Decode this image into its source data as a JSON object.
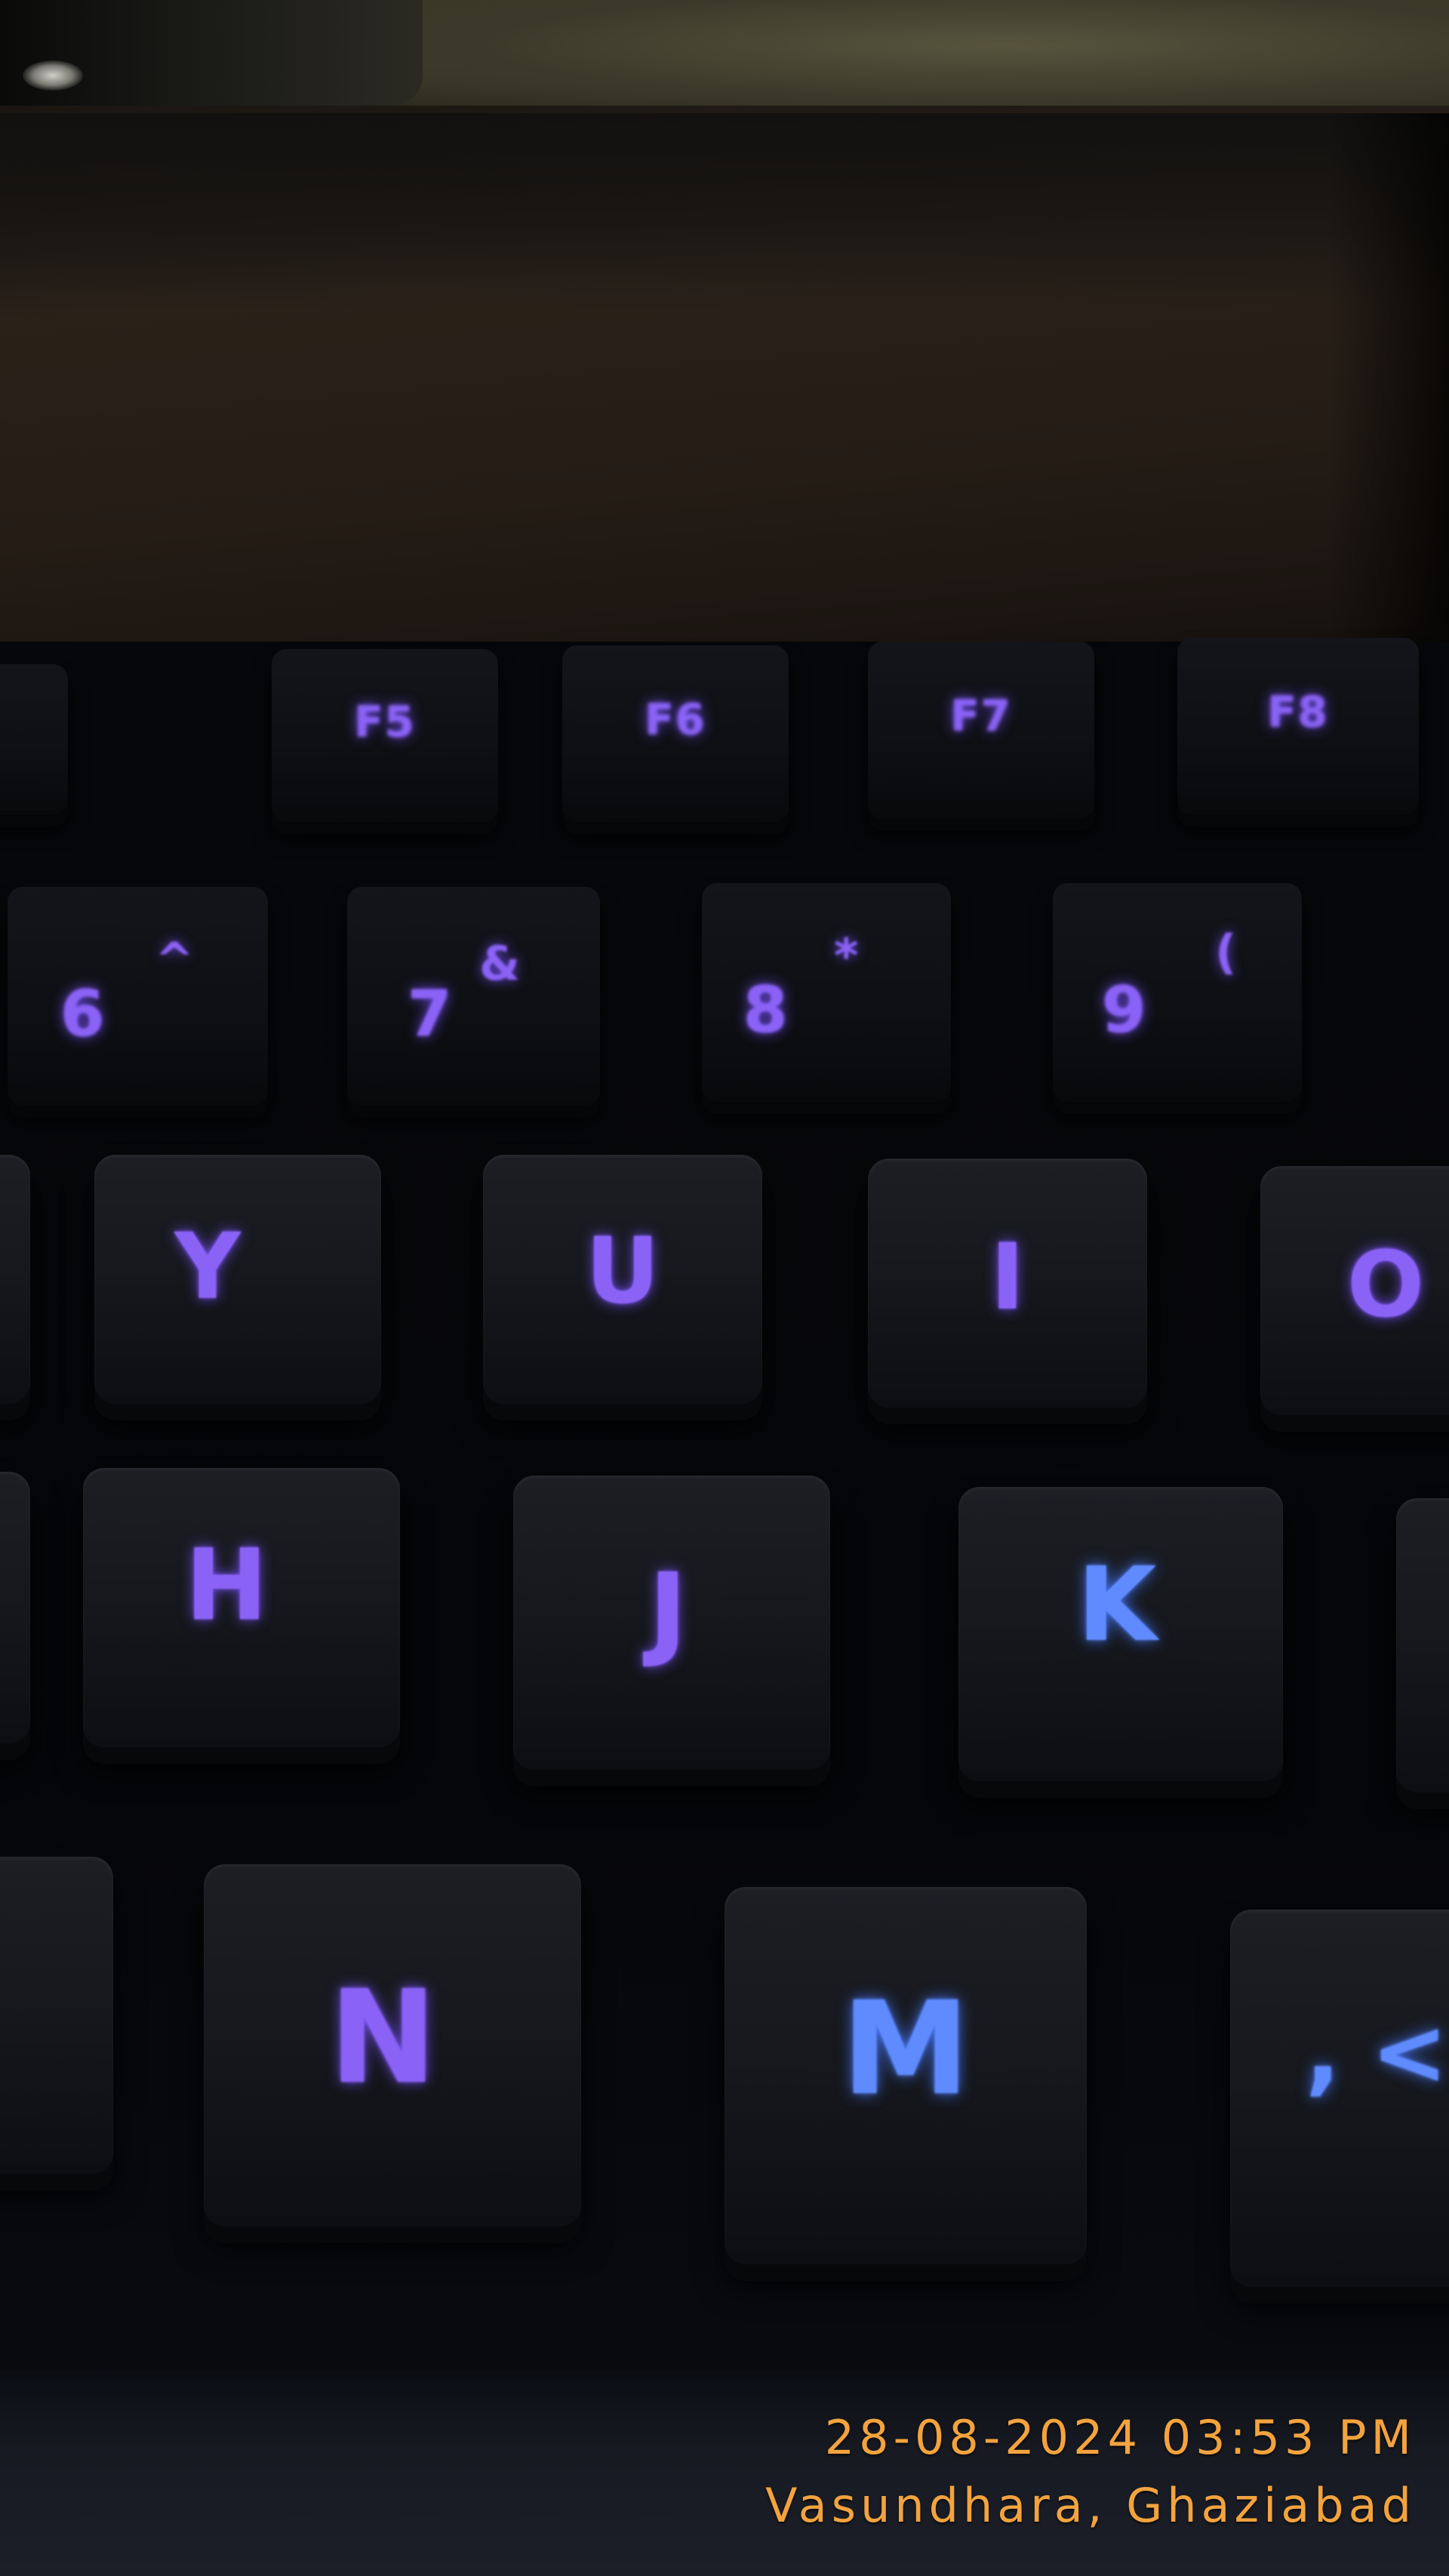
{
  "photo": {
    "subject": "backlit keyboard",
    "backlight_color": "#8a62f5",
    "backlight_color_bright": "#5f8bff",
    "stamp_color": "#f3a33e"
  },
  "keys": {
    "f5": "F5",
    "f6": "F6",
    "f7": "F7",
    "f8": "F8",
    "six": "6",
    "six_shift": "^",
    "seven": "7",
    "seven_shift": "&",
    "eight": "8",
    "eight_shift": "*",
    "nine": "9",
    "nine_shift": "(",
    "y": "Y",
    "u": "U",
    "i": "I",
    "o": "O",
    "h": "H",
    "j": "J",
    "k": "K",
    "n": "N",
    "m": "M",
    "comma": ", <"
  },
  "stamp": {
    "datetime": "28-08-2024 03:53 PM",
    "location": "Vasundhara, Ghaziabad"
  }
}
